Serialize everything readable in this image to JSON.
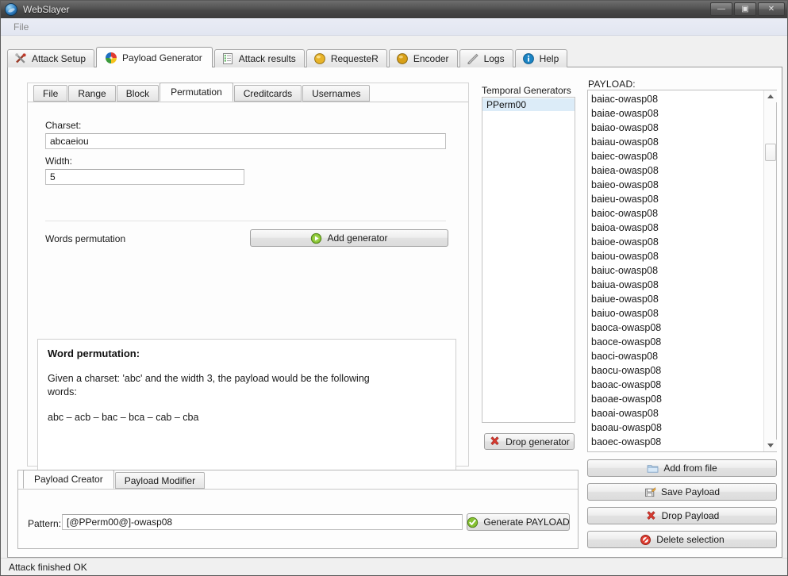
{
  "window": {
    "title": "WebSlayer",
    "app_icon": "globe-icon",
    "buttons": {
      "minimize": "—",
      "maximize": "▣",
      "close": "✕"
    }
  },
  "menubar": {
    "items": [
      "File"
    ]
  },
  "main_tabs": [
    {
      "label": "Attack Setup",
      "icon": "tools-icon",
      "active": false
    },
    {
      "label": "Payload Generator",
      "icon": "pinwheel-icon",
      "active": true
    },
    {
      "label": "Attack results",
      "icon": "list-icon",
      "active": false
    },
    {
      "label": "RequesteR",
      "icon": "gold-ball-icon",
      "active": false
    },
    {
      "label": "Encoder",
      "icon": "gold-ball-icon",
      "active": false
    },
    {
      "label": "Logs",
      "icon": "pencil-icon",
      "active": false
    },
    {
      "label": "Help",
      "icon": "info-icon",
      "active": false
    }
  ],
  "generator": {
    "tabs": [
      {
        "label": "File",
        "active": false
      },
      {
        "label": "Range",
        "active": false
      },
      {
        "label": "Block",
        "active": false
      },
      {
        "label": "Permutation",
        "active": true
      },
      {
        "label": "Creditcards",
        "active": false
      },
      {
        "label": "Usernames",
        "active": false
      }
    ],
    "charset_label": "Charset:",
    "charset_value": "abcaeiou",
    "width_label": "Width:",
    "width_value": "5",
    "type_label": "Words permutation",
    "add_generator_label": "Add generator",
    "add_generator_icon": "green-play-icon",
    "description": {
      "title": "Word permutation:",
      "paragraph": "Given a charset: 'abc' and the width 3, the payload  would be the following words:",
      "words": "abc – acb – bac – bca – cab – cba"
    }
  },
  "temporal": {
    "label": "Temporal Generators",
    "items": [
      "PPerm00"
    ],
    "drop_label": "Drop generator",
    "drop_icon": "red-x-icon"
  },
  "payload": {
    "label": "PAYLOAD:",
    "items": [
      "baiac-owasp08",
      "baiae-owasp08",
      "baiao-owasp08",
      "baiau-owasp08",
      "baiec-owasp08",
      "baiea-owasp08",
      "baieo-owasp08",
      "baieu-owasp08",
      "baioc-owasp08",
      "baioa-owasp08",
      "baioe-owasp08",
      "baiou-owasp08",
      "baiuc-owasp08",
      "baiua-owasp08",
      "baiue-owasp08",
      "baiuo-owasp08",
      "baoca-owasp08",
      "baoce-owasp08",
      "baoci-owasp08",
      "baocu-owasp08",
      "baoac-owasp08",
      "baoae-owasp08",
      "baoai-owasp08",
      "baoau-owasp08",
      "baoec-owasp08"
    ],
    "buttons": [
      {
        "label": "Add from file",
        "icon": "folder-icon"
      },
      {
        "label": "Save Payload",
        "icon": "save-icon"
      },
      {
        "label": "Drop Payload",
        "icon": "red-x-icon"
      },
      {
        "label": "Delete selection",
        "icon": "no-entry-icon"
      }
    ]
  },
  "creator": {
    "tabs": [
      {
        "label": "Payload Creator",
        "active": true
      },
      {
        "label": "Payload Modifier",
        "active": false
      }
    ],
    "pattern_label": "Pattern:",
    "pattern_value": "[@PPerm00@]-owasp08",
    "generate_label": "Generate PAYLOAD",
    "generate_icon": "green-check-icon"
  },
  "statusbar": {
    "text": "Attack finished OK"
  },
  "colors": {
    "titlebar": "#4a4a4a",
    "panel": "#fdfdfd",
    "selection": "#dcecf8",
    "accent_green": "#6fbf2e",
    "accent_red": "#d33a32"
  }
}
